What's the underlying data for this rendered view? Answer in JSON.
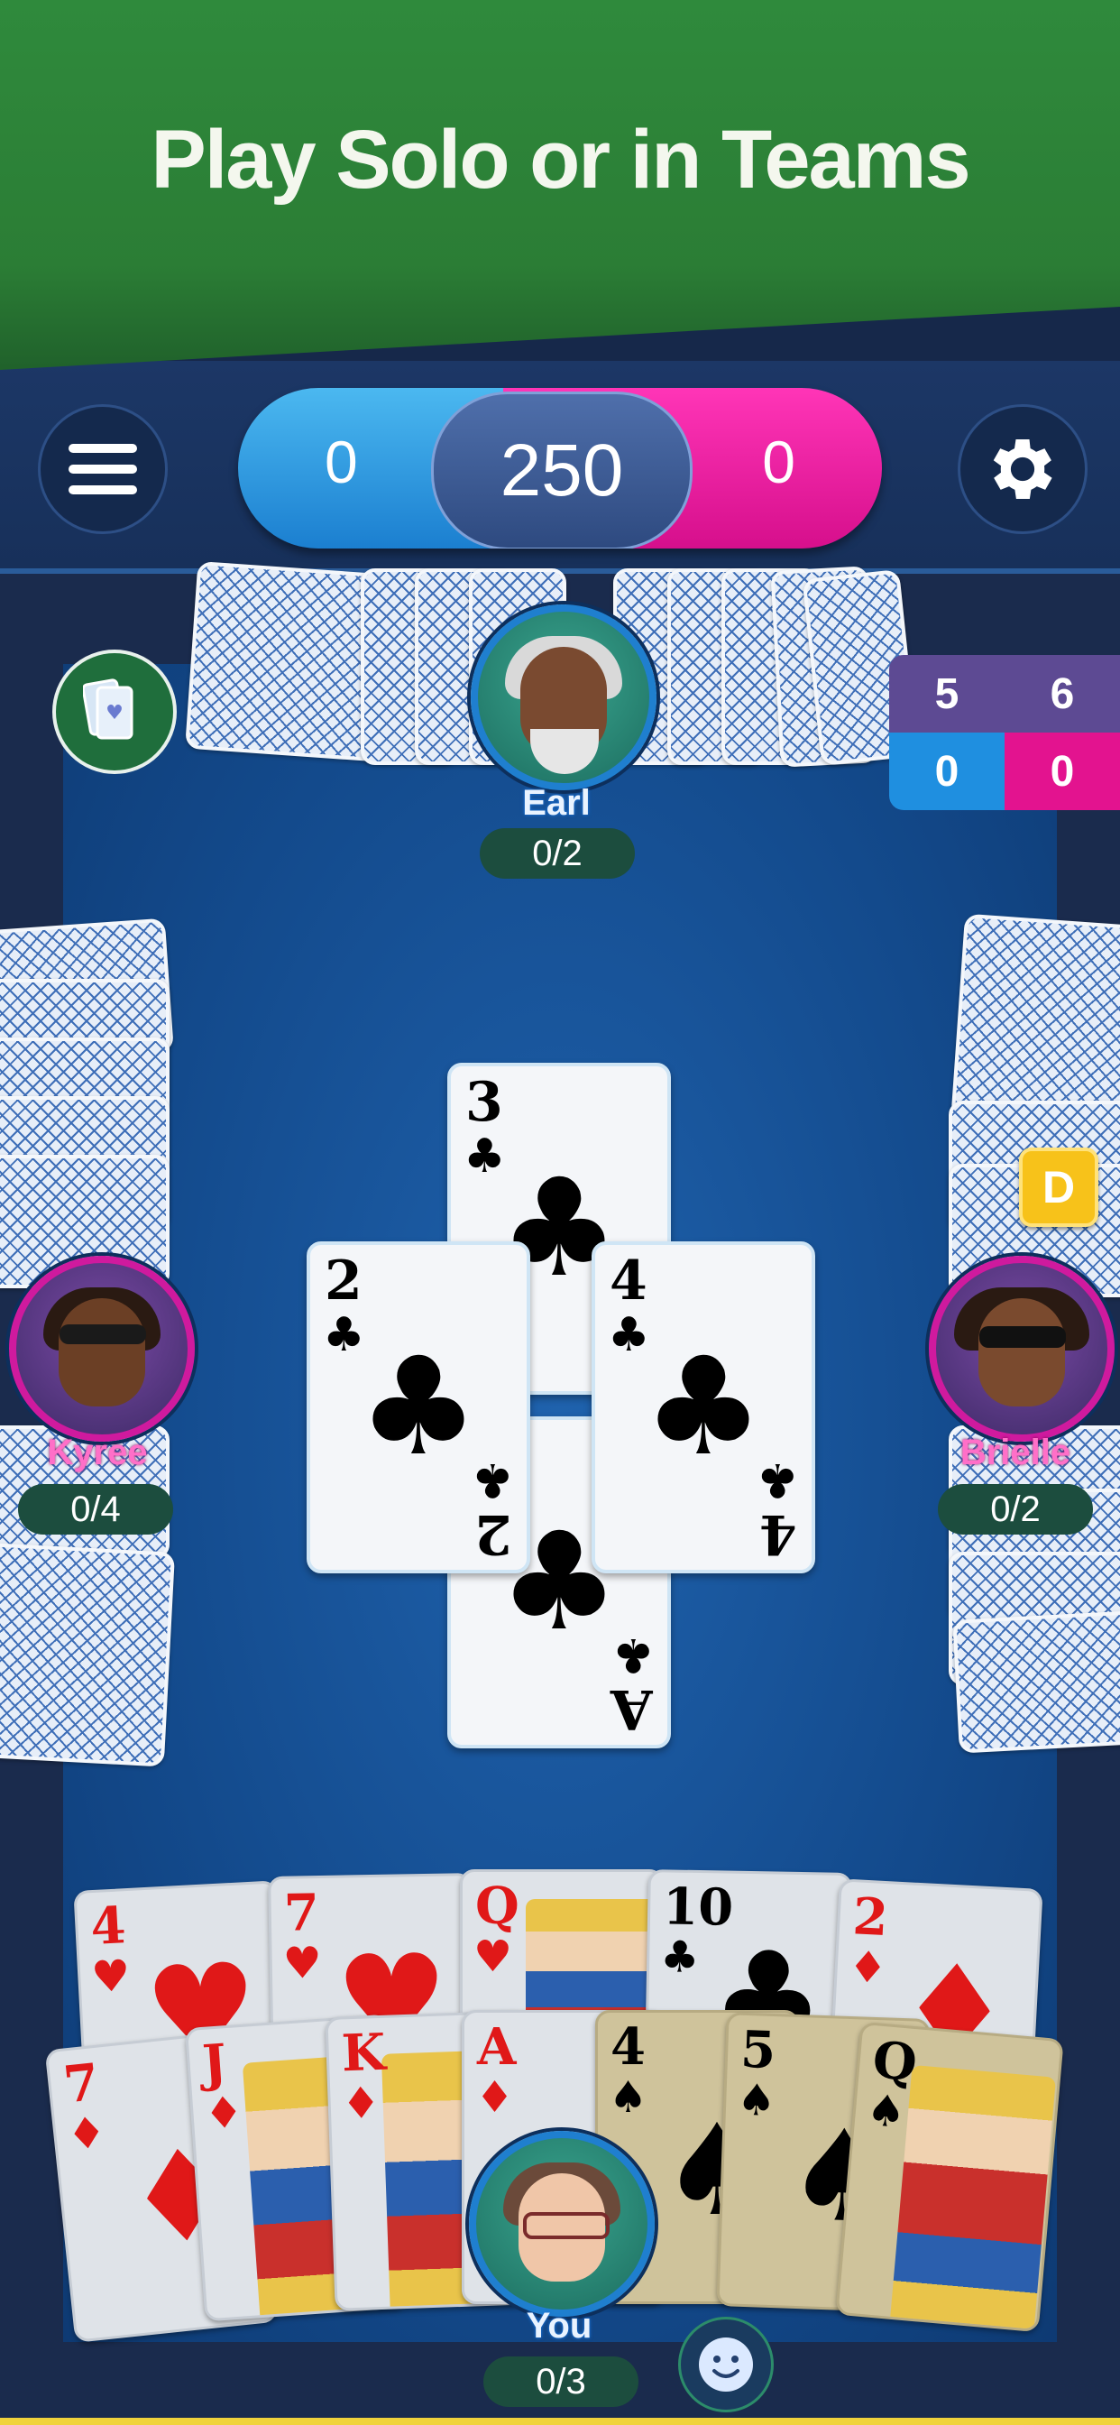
{
  "banner": {
    "title": "Play Solo or in Teams"
  },
  "topbar": {
    "menu_icon": "hamburger-icon",
    "settings_icon": "gear-icon",
    "score": {
      "left": "0",
      "target": "250",
      "right": "0"
    }
  },
  "team_scores": {
    "top_left": "5",
    "top_right": "6",
    "bottom_left": "0",
    "bottom_right": "0"
  },
  "players": {
    "north": {
      "name": "Earl",
      "tricks": "0/2"
    },
    "west": {
      "name": "Kyree",
      "tricks": "0/4"
    },
    "east": {
      "name": "Brielle",
      "tricks": "0/2"
    },
    "south": {
      "name": "You",
      "tricks": "0/3"
    }
  },
  "dealer_badge": "D",
  "trick_cards": [
    {
      "rank": "3",
      "suit": "♣"
    },
    {
      "rank": "2",
      "suit": "♣"
    },
    {
      "rank": "4",
      "suit": "♣"
    },
    {
      "rank": "A",
      "suit": "♣"
    }
  ],
  "hand_back_row": [
    {
      "rank": "4",
      "suit": "♥"
    },
    {
      "rank": "7",
      "suit": "♥"
    },
    {
      "rank": "Q",
      "suit": "♥"
    },
    {
      "rank": "10",
      "suit": "♣"
    },
    {
      "rank": "2",
      "suit": "♦"
    }
  ],
  "hand_front_row": [
    {
      "rank": "7",
      "suit": "♦"
    },
    {
      "rank": "J",
      "suit": "♦"
    },
    {
      "rank": "K",
      "suit": "♦"
    },
    {
      "rank": "A",
      "suit": "♦"
    },
    {
      "rank": "4",
      "suit": "♠"
    },
    {
      "rank": "5",
      "suit": "♠"
    },
    {
      "rank": "Q",
      "suit": "♠"
    }
  ],
  "colors": {
    "team_blue": "#1b8fe0",
    "team_pink": "#e3138f",
    "felt": "#134a8c",
    "banner_green": "#2f8a3c"
  }
}
